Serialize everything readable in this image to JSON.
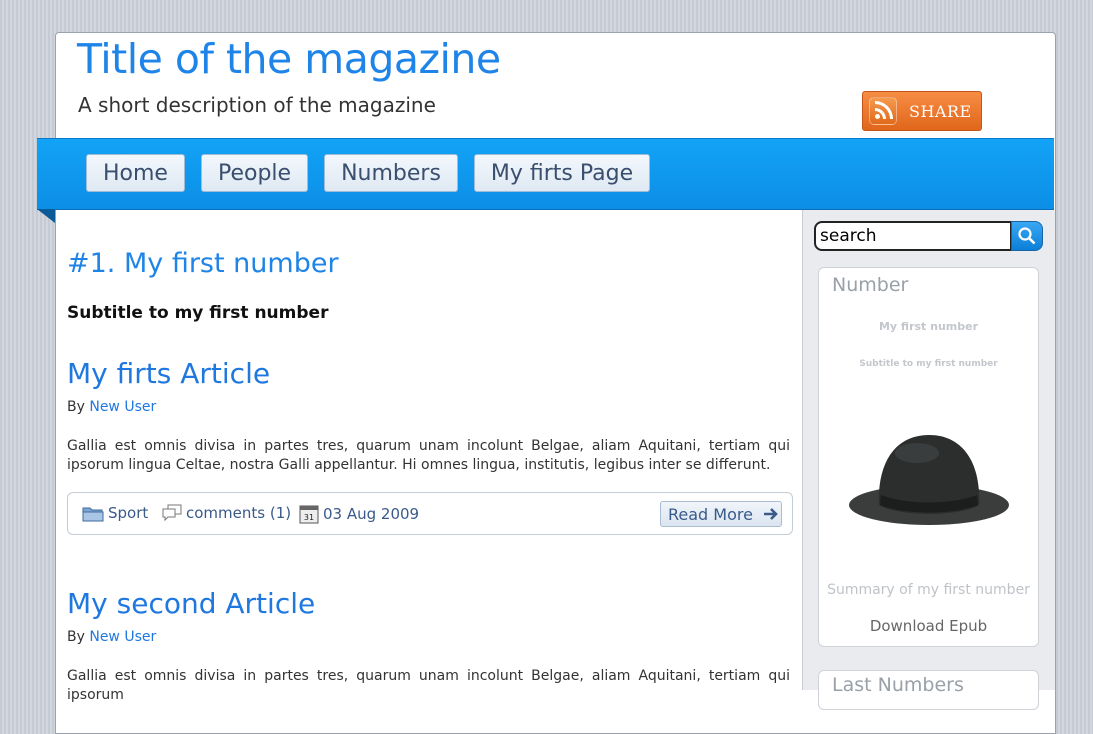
{
  "header": {
    "title": "Title of the magazine",
    "description": "A short description of the magazine",
    "share_label": "SHARE"
  },
  "nav": {
    "items": [
      {
        "label": "Home"
      },
      {
        "label": "People"
      },
      {
        "label": "Numbers"
      },
      {
        "label": "My firts Page"
      }
    ]
  },
  "main": {
    "number_heading": "#1. My first number",
    "number_subtitle": "Subtitle to my first number",
    "articles": [
      {
        "title": "My firts Article",
        "by": "By ",
        "author": "New User",
        "excerpt": "Gallia est omnis divisa in partes tres, quarum unam incolunt Belgae, aliam Aquitani, tertiam qui ipsorum lingua Celtae, nostra Galli appellantur. Hi omnes lingua, institutis, legibus inter se differunt.",
        "category": "Sport",
        "comments": "comments (1)",
        "date": "03 Aug 2009",
        "read_more": "Read More"
      },
      {
        "title": "My second Article",
        "by": "By ",
        "author": "New User",
        "excerpt": "Gallia est omnis divisa in partes tres, quarum unam incolunt Belgae, aliam Aquitani, tertiam qui ipsorum"
      }
    ]
  },
  "sidebar": {
    "search_value": "search",
    "number_card": {
      "title": "Number",
      "sub1": "My first number",
      "sub2": "Subtitle to my first number",
      "summary": "Summary of my first number",
      "download": "Download Epub"
    },
    "last_numbers_title": "Last Numbers"
  },
  "icons": {
    "share": "rss-icon",
    "search": "search-icon",
    "category": "folder-icon",
    "comments": "comments-icon",
    "date": "calendar-icon",
    "read_more": "arrow-right-icon"
  },
  "colors": {
    "accent": "#1f84e8",
    "nav_bar": "#0c8ee6",
    "share": "#e8702a"
  }
}
